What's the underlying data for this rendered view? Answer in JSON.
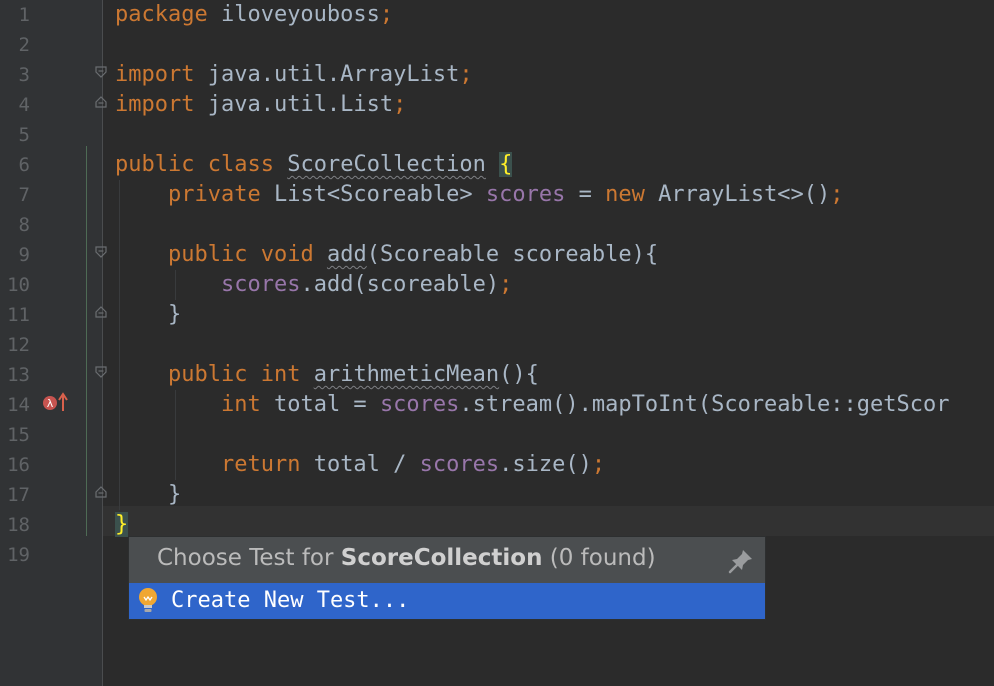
{
  "editor": {
    "line_numbers": [
      "1",
      "2",
      "3",
      "4",
      "5",
      "6",
      "7",
      "8",
      "9",
      "10",
      "11",
      "12",
      "13",
      "14",
      "15",
      "16",
      "17",
      "18",
      "19"
    ],
    "lines": {
      "l1": {
        "kw": "package",
        "rest": " iloveyouboss",
        "semi": ";"
      },
      "l3": {
        "kw": "import",
        "rest": " java.util.ArrayList",
        "semi": ";"
      },
      "l4": {
        "kw": "import",
        "rest": " java.util.List",
        "semi": ";"
      },
      "l6": {
        "kw1": "public",
        "kw2": " class",
        "name": "ScoreCollection",
        "brace": "{"
      },
      "l7": {
        "kw": "private",
        "type": " List<Scoreable> ",
        "field": "scores",
        "eq": " = ",
        "kw2": "new",
        "rest": " ArrayList<>()",
        "semi": ";"
      },
      "l9": {
        "kw1": "public",
        "kw2": " void",
        "name": "add",
        "rest": "(Scoreable scoreable){"
      },
      "l10": {
        "field": "scores",
        "rest": ".add(scoreable)",
        "semi": ";"
      },
      "l11": {
        "text": "}"
      },
      "l13": {
        "kw1": "public",
        "kw2": " int",
        "name": "arithmeticMean",
        "rest": "(){"
      },
      "l14": {
        "kw": "int",
        "mid": " total = ",
        "field": "scores",
        "rest": ".stream().mapToInt(Scoreable::getScor"
      },
      "l16": {
        "kw": "return",
        "mid": " total / ",
        "field": "scores",
        "rest": ".size()",
        "semi": ";"
      },
      "l17": {
        "text": "}"
      },
      "l18": {
        "brace": "}"
      }
    }
  },
  "popup": {
    "title_prefix": "Choose Test for ",
    "title_class": "ScoreCollection",
    "title_suffix": " (0 found)",
    "item_label": "Create New Test..."
  },
  "icons": {
    "fold": "fold-marker-icon",
    "lambda": "lambda-override-icon",
    "pin": "pin-icon",
    "bulb": "lightbulb-icon"
  },
  "colors": {
    "background": "#2b2b2b",
    "keyword": "#cc7832",
    "field": "#9876aa",
    "text": "#a9b7c6",
    "selection": "#2f65ca",
    "brace_highlight": "#ffef28"
  }
}
